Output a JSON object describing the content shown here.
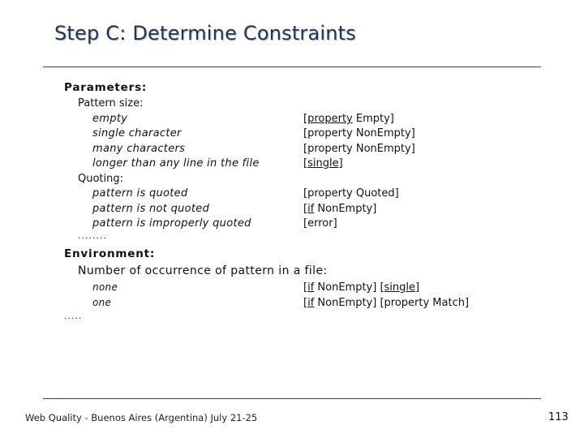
{
  "title": "Step C: Determine Constraints",
  "parameters": {
    "heading": "Parameters:",
    "pattern_size": {
      "label": "Pattern size:",
      "rows": [
        {
          "choice": "empty",
          "constraint_prefix": "[",
          "constraint_keyword": "property",
          "constraint_rest": " Empty]"
        },
        {
          "choice": "single character",
          "constraint_prefix": "[",
          "constraint_keyword": "property",
          "constraint_rest": " NonEmpty]"
        },
        {
          "choice": "many characters",
          "constraint_prefix": "[",
          "constraint_keyword": "property",
          "constraint_rest": " NonEmpty]"
        },
        {
          "choice": "longer than any line in the file",
          "constraint_prefix": "[",
          "constraint_keyword": "single",
          "constraint_rest": "]"
        }
      ]
    },
    "quoting": {
      "label": "Quoting:",
      "rows": [
        {
          "choice": "pattern is quoted",
          "constraint_prefix": "[",
          "constraint_keyword": "property",
          "constraint_rest": " Quoted]"
        },
        {
          "choice": "pattern is not quoted",
          "constraint_prefix": "[",
          "constraint_keyword": "if",
          "constraint_rest": " NonEmpty]"
        },
        {
          "choice": "pattern is improperly quoted",
          "constraint_prefix": "[",
          "constraint_keyword": "error",
          "constraint_rest": "]"
        }
      ]
    },
    "ellipsis": "........"
  },
  "environment": {
    "heading": "Environment:",
    "occurrence": {
      "label": "Number of occurrence of pattern in a file:",
      "rows": [
        {
          "choice": "none",
          "c1_prefix": "[",
          "c1_keyword": "if",
          "c1_rest": " NonEmpty] [",
          "c2_keyword": "single",
          "c2_rest": "]"
        },
        {
          "choice": "one",
          "c1_prefix": "[",
          "c1_keyword": "if",
          "c1_rest": " NonEmpty] [property Match]",
          "c2_keyword": "",
          "c2_rest": ""
        }
      ]
    },
    "ellipsis": "....."
  },
  "footer": {
    "text": "Web Quality - Buenos Aires (Argentina) July 21-25",
    "page_number": "113"
  }
}
